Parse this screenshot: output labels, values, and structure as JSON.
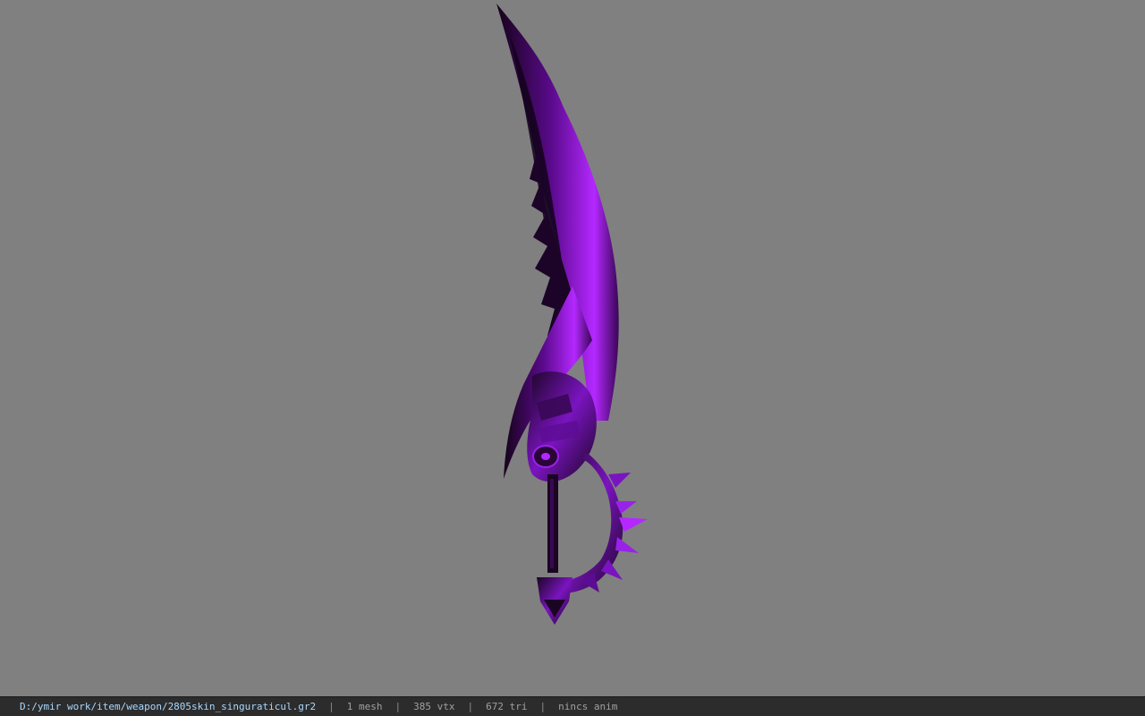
{
  "viewer": {
    "background_color": "#808080",
    "model": {
      "icon": "weapon-model",
      "primary_color": "#8a12d6",
      "highlight_color": "#b428ff",
      "shadow_color": "#1a0522"
    }
  },
  "status_bar": {
    "file_path": "D:/ymir work/item/weapon/2805skin_singuraticul.gr2",
    "separator": "|",
    "mesh": "1 mesh",
    "vertices": "385 vtx",
    "triangles": "672 tri",
    "animation": "nincs anim"
  }
}
